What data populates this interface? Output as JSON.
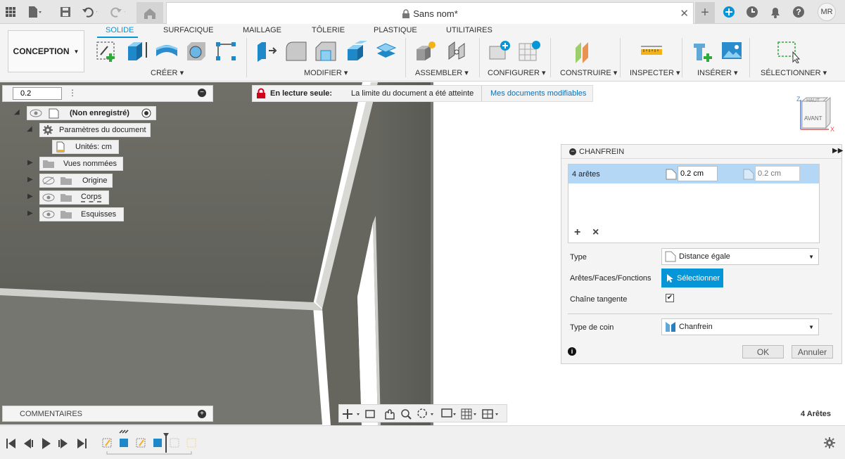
{
  "titlebar": {
    "document_title": "Sans nom*",
    "user_initials": "MR",
    "icons": [
      "apps-grid-icon",
      "file-icon",
      "save-icon",
      "undo-icon",
      "redo-icon",
      "home-icon",
      "lock-icon",
      "close-icon",
      "new-tab-icon",
      "extension-icon",
      "clock-icon",
      "bell-icon",
      "help-icon"
    ]
  },
  "ribbon": {
    "workspace": "CONCEPTION",
    "tabs": [
      {
        "label": "SOLIDE",
        "active": true
      },
      {
        "label": "SURFACIQUE"
      },
      {
        "label": "MAILLAGE"
      },
      {
        "label": "TÔLERIE"
      },
      {
        "label": "PLASTIQUE"
      },
      {
        "label": "UTILITAIRES"
      }
    ],
    "groups": [
      {
        "label": "CRÉER"
      },
      {
        "label": "MODIFIER"
      },
      {
        "label": "ASSEMBLER"
      },
      {
        "label": "CONFIGURER"
      },
      {
        "label": "CONSTRUIRE"
      },
      {
        "label": "INSPECTER"
      },
      {
        "label": "INSÉRER"
      },
      {
        "label": "SÉLECTIONNER"
      }
    ]
  },
  "browser": {
    "input_value": "0.2",
    "root": "(Non enregistré)",
    "items": [
      {
        "label": "Paramètres du document"
      },
      {
        "label": "Unités: cm"
      },
      {
        "label": "Vues nommées"
      },
      {
        "label": "Origine"
      },
      {
        "label": "Corps"
      },
      {
        "label": "Esquisses"
      }
    ]
  },
  "banner": {
    "title": "En lecture seule:",
    "message": "La limite du document a été atteinte",
    "link": "Mes documents modifiables"
  },
  "viewcube": {
    "front": "AVANT",
    "top": "HAUT",
    "axis_z": "Z",
    "axis_x": "X"
  },
  "chamfer": {
    "title": "CHANFREIN",
    "selection_label": "4 arêtes",
    "distance1": "0.2 cm",
    "distance2_placeholder": "0.2 cm",
    "add_symbol": "+",
    "remove_symbol": "×",
    "type_label": "Type",
    "type_value": "Distance égale",
    "edges_label": "Arêtes/Faces/Fonctions",
    "select_button": "Sélectionner",
    "tangent_label": "Chaîne tangente",
    "tangent_checked": true,
    "corner_label": "Type de coin",
    "corner_value": "Chanfrein",
    "ok": "OK",
    "cancel": "Annuler"
  },
  "comments": {
    "label": "COMMENTAIRES"
  },
  "status": {
    "selection_count": "4 Arêtes"
  },
  "colors": {
    "accent": "#0696d7",
    "model": "#6d6d68"
  }
}
